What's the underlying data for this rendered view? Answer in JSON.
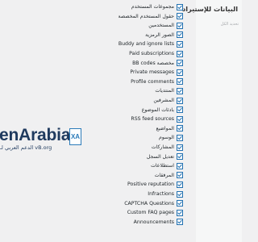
{
  "sidebar": {
    "title": "البيانات للإستيراد",
    "select_all": "تحديد الكل"
  },
  "logo": {
    "text": "enArabia",
    "subtitle": "الدعم العربي لـ vB.org",
    "badge": "XA"
  },
  "options": [
    {
      "label": "مجموعات المستخدم",
      "checked": true
    },
    {
      "label": "حقول المستخدم المخصصة",
      "checked": true
    },
    {
      "label": "المستخدمين",
      "checked": true
    },
    {
      "label": "الصور الرمزية",
      "checked": true
    },
    {
      "label": "Buddy and ignore lists",
      "checked": true
    },
    {
      "label": "Paid subscriptions",
      "checked": true
    },
    {
      "label": "BB codes مخصصة",
      "checked": true
    },
    {
      "label": "Private messages",
      "checked": true
    },
    {
      "label": "Profile comments",
      "checked": true
    },
    {
      "label": "المنتديات",
      "checked": true
    },
    {
      "label": "المشرفين",
      "checked": true
    },
    {
      "label": "بادئات الموضوع",
      "checked": true
    },
    {
      "label": "RSS feed sources",
      "checked": true
    },
    {
      "label": "المواضيع",
      "checked": true
    },
    {
      "label": "الوسوم",
      "checked": true
    },
    {
      "label": "المشاركات",
      "checked": true
    },
    {
      "label": "تعديل السجل",
      "checked": true
    },
    {
      "label": "استطلاعات",
      "checked": true
    },
    {
      "label": "المرفقات",
      "checked": true
    },
    {
      "label": "Positive reputation",
      "checked": true
    },
    {
      "label": "Infractions",
      "checked": true
    },
    {
      "label": "CAPTCHA Questions",
      "checked": true
    },
    {
      "label": "Custom FAQ pages",
      "checked": true
    },
    {
      "label": "Announcements",
      "checked": true
    }
  ],
  "colors": {
    "checkbox_border": "#2271b1",
    "check_mark": "#2271b1",
    "logo_text": "#1f3a5e"
  }
}
